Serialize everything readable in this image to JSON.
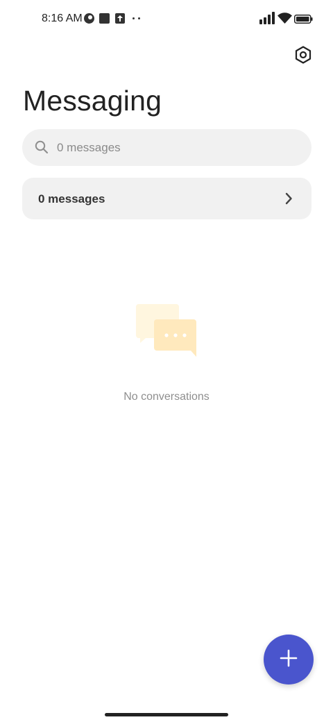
{
  "status_bar": {
    "time": "8:16 AM",
    "icons": [
      "notification-pie-icon",
      "notification-square-icon",
      "notification-upload-icon",
      "more-notifications-icon",
      "cellular-signal-icon",
      "wifi-icon",
      "battery-icon"
    ]
  },
  "header": {
    "title": "Messaging",
    "settings_icon": "settings-hexagon-icon"
  },
  "search": {
    "placeholder": "0 messages",
    "value": "",
    "icon": "search-icon"
  },
  "messages_row": {
    "label": "0 messages",
    "icon": "chevron-right-icon"
  },
  "empty_state": {
    "icon": "chat-bubbles-icon",
    "text": "No conversations"
  },
  "fab": {
    "icon": "plus-icon",
    "color": "#4a55cd"
  },
  "colors": {
    "accent": "#4a55cd",
    "surface": "#f1f1f1",
    "illustration_light": "#fff6df",
    "illustration_dark": "#ffe9bd"
  }
}
